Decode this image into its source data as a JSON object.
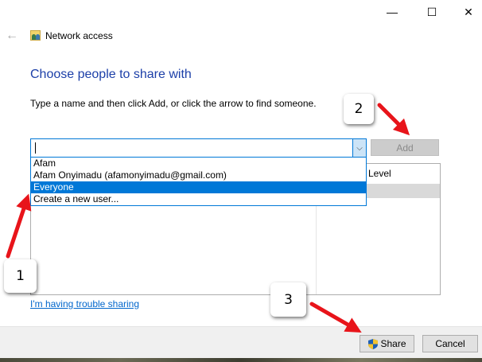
{
  "window": {
    "title": "Network access",
    "minimize": "—",
    "maximize": "☐",
    "close": "✕"
  },
  "heading": "Choose people to share with",
  "instruction": "Type a name and then click Add, or click the arrow to find someone.",
  "combo": {
    "value": "",
    "arrow": "⌵"
  },
  "add_label": "Add",
  "list": {
    "level_header": "Level"
  },
  "dropdown": {
    "items": [
      "Afam",
      "Afam Onyimadu (afamonyimadu@gmail.com)",
      "Everyone",
      "Create a new user..."
    ],
    "selected": "Everyone"
  },
  "trouble_link": "I'm having trouble sharing",
  "share_label": "Share",
  "cancel_label": "Cancel",
  "callouts": [
    "1",
    "2",
    "3"
  ],
  "colors": {
    "accent": "#0078d7",
    "heading": "#1c3fa8",
    "arrow": "#e8141a"
  }
}
